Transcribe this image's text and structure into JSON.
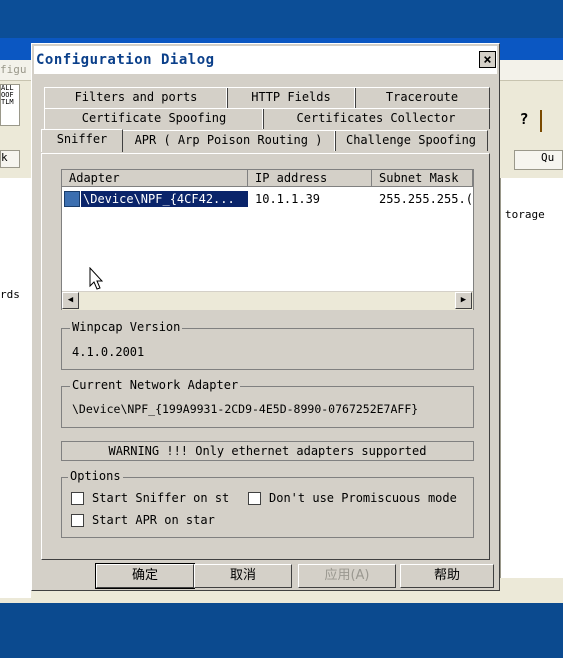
{
  "background_app": {
    "left_partial_text": "figu",
    "left_label": "rds",
    "left_tab_label": "k",
    "right_tab_label": "Qu",
    "right_column_header": "torage",
    "toolbar_icons": [
      "help-icon",
      "brush-icon"
    ]
  },
  "dialog": {
    "title": "Configuration Dialog",
    "close_glyph": "×",
    "tabs_row1": [
      "Filters and ports",
      "HTTP Fields",
      "Traceroute"
    ],
    "tabs_row2": [
      "Certificate Spoofing",
      "Certificates Collector"
    ],
    "tabs_row3": [
      "Sniffer",
      "APR ( Arp Poison Routing )",
      "Challenge Spoofing"
    ],
    "active_tab": "Sniffer",
    "adapter_list": {
      "columns": [
        "Adapter",
        "IP address",
        "Subnet Mask"
      ],
      "rows": [
        {
          "adapter": "\\Device\\NPF_{4CF42...",
          "ip": "10.1.1.39",
          "mask": "255.255.255.("
        }
      ]
    },
    "winpcap": {
      "legend": "Winpcap Version",
      "value": "4.1.0.2001"
    },
    "current_adapter": {
      "legend": "Current Network Adapter",
      "value": "\\Device\\NPF_{199A9931-2CD9-4E5D-8990-0767252E7AFF}"
    },
    "warning": "WARNING !!! Only ethernet adapters supported",
    "options": {
      "legend": "Options",
      "start_sniffer": "Start Sniffer on st",
      "no_promiscuous": "Don't use Promiscuous mode",
      "start_apr": "Start APR on star"
    },
    "buttons": {
      "ok": "确定",
      "cancel": "取消",
      "apply": "应用(A)",
      "help": "帮助"
    }
  }
}
